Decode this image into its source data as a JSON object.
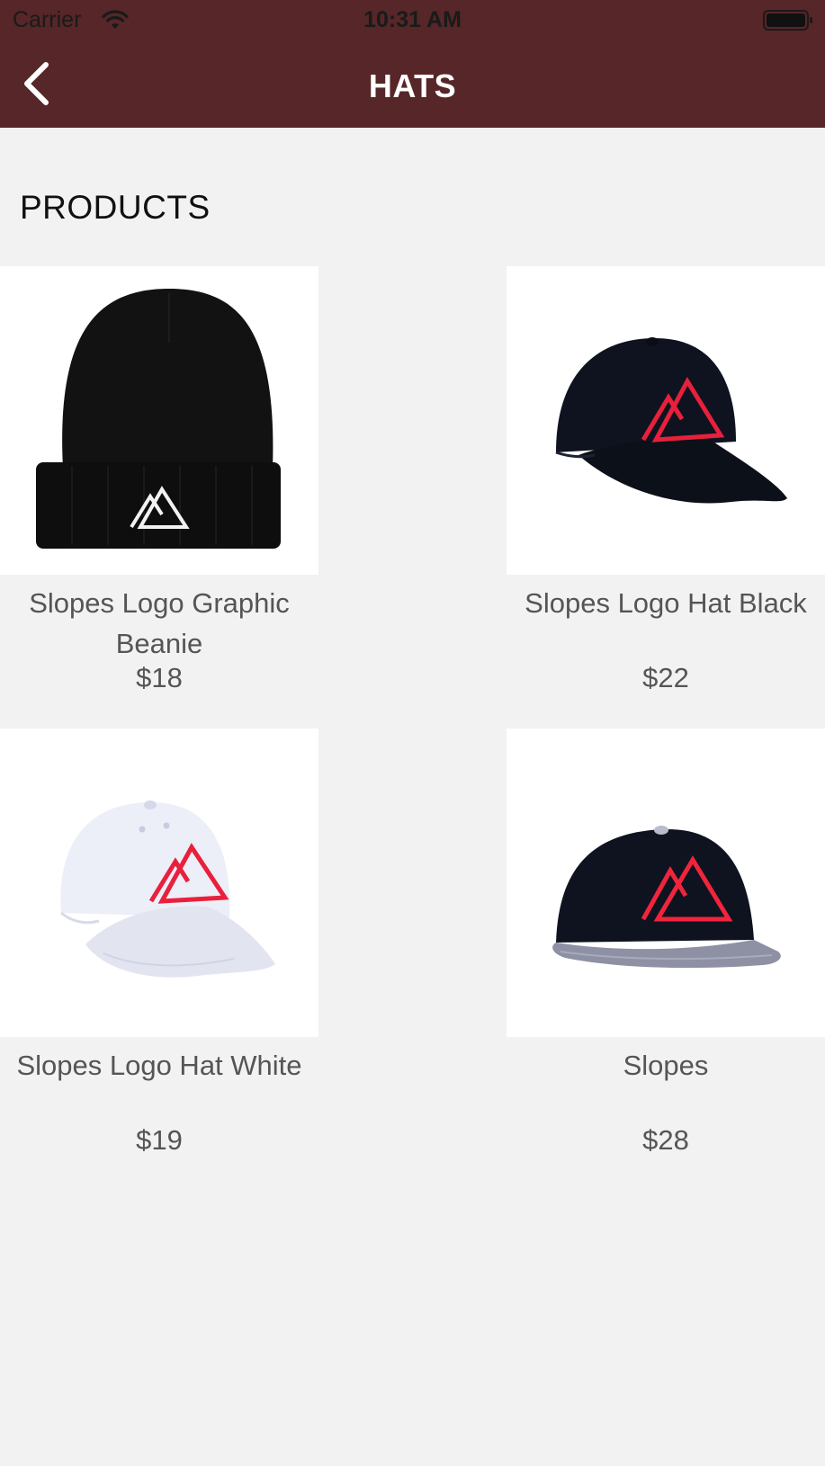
{
  "status_bar": {
    "carrier": "Carrier",
    "time": "10:31 AM",
    "wifi_icon": "wifi-icon",
    "battery_icon": "battery-icon"
  },
  "nav": {
    "title": "HATS",
    "back_icon": "chevron-left-icon",
    "background_color": "#562628"
  },
  "section": {
    "title": "PRODUCTS"
  },
  "products": [
    {
      "name": "Slopes Logo Graphic Beanie",
      "price": "$18",
      "image": "black-beanie-white-logo"
    },
    {
      "name": "Slopes Logo Hat Black",
      "price": "$22",
      "image": "black-cap-red-logo"
    },
    {
      "name": "Slopes Logo Hat White",
      "price": "$19",
      "image": "white-cap-red-logo"
    },
    {
      "name": "Slopes",
      "price": "$28",
      "image": "black-snapback-grey-brim-red-logo"
    }
  ]
}
